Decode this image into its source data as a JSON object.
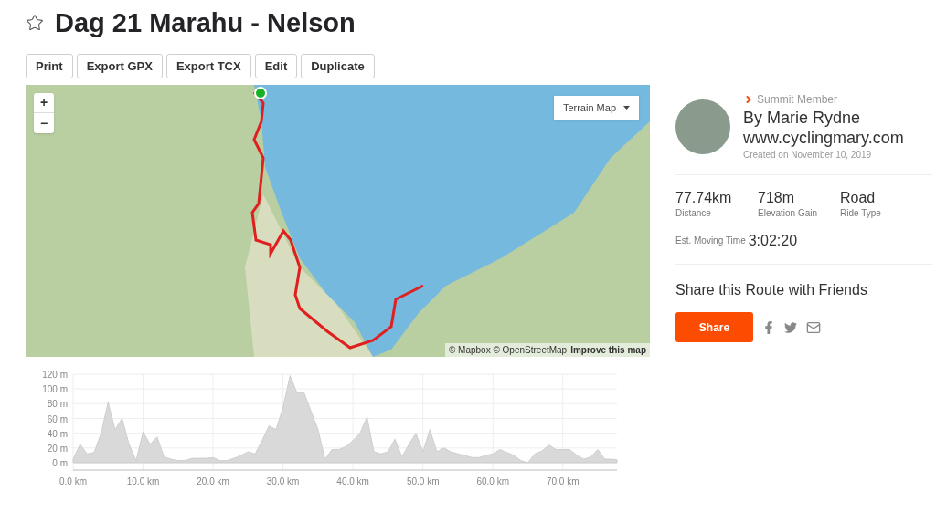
{
  "route": {
    "title": "Dag 21 Marahu - Nelson",
    "starred": false
  },
  "actions": [
    "Print",
    "Export GPX",
    "Export TCX",
    "Edit",
    "Duplicate"
  ],
  "map": {
    "zoom_in": "+",
    "zoom_out": "−",
    "style_menu": "Terrain Map",
    "attribution": "© Mapbox © OpenStreetMap",
    "improve_link": "Improve this map"
  },
  "elevation": {
    "chart_data": {
      "type": "area",
      "grid": true,
      "x": [
        0,
        1,
        2,
        3,
        4,
        5,
        6,
        7,
        8,
        9,
        10,
        11,
        12,
        13,
        14,
        15,
        16,
        17,
        18,
        19,
        20,
        21,
        22,
        23,
        24,
        25,
        26,
        27,
        28,
        29,
        30,
        31,
        32,
        33,
        34,
        35,
        36,
        37,
        38,
        39,
        40,
        41,
        42,
        43,
        44,
        45,
        46,
        47,
        48,
        49,
        50,
        51,
        52,
        53,
        54,
        55,
        56,
        57,
        58,
        59,
        60,
        61,
        62,
        63,
        64,
        65,
        66,
        67,
        68,
        69,
        70,
        71,
        72,
        73,
        74,
        75,
        76,
        77,
        77.74
      ],
      "series": [
        {
          "color": "#d9d9d9",
          "values": [
            5,
            25,
            12,
            14,
            40,
            82,
            45,
            60,
            25,
            3,
            42,
            25,
            35,
            8,
            5,
            3,
            3,
            6,
            6,
            6,
            7,
            3,
            3,
            6,
            10,
            15,
            12,
            30,
            50,
            45,
            75,
            118,
            95,
            95,
            70,
            45,
            5,
            18,
            18,
            22,
            30,
            40,
            62,
            15,
            12,
            15,
            32,
            8,
            25,
            40,
            15,
            45,
            15,
            20,
            15,
            12,
            10,
            7,
            7,
            10,
            12,
            18,
            14,
            10,
            3,
            0,
            12,
            16,
            24,
            18,
            18,
            18,
            10,
            5,
            8,
            18,
            5,
            5,
            4
          ]
        }
      ],
      "xlim": [
        0,
        77.74
      ],
      "ylim": [
        0,
        120
      ],
      "xticks": [
        {
          "value": 0,
          "label": "0.0 km"
        },
        {
          "value": 10,
          "label": "10.0 km"
        },
        {
          "value": 20,
          "label": "20.0 km"
        },
        {
          "value": 30,
          "label": "30.0 km"
        },
        {
          "value": 40,
          "label": "40.0 km"
        },
        {
          "value": 50,
          "label": "50.0 km"
        },
        {
          "value": 60,
          "label": "60.0 km"
        },
        {
          "value": 70,
          "label": "70.0 km"
        }
      ],
      "yticks": [
        {
          "value": 0,
          "label": "0 m"
        },
        {
          "value": 20,
          "label": "20 m"
        },
        {
          "value": 40,
          "label": "40 m"
        },
        {
          "value": 60,
          "label": "60 m"
        },
        {
          "value": 80,
          "label": "80 m"
        },
        {
          "value": 100,
          "label": "100 m"
        },
        {
          "value": 120,
          "label": "120 m"
        }
      ]
    }
  },
  "author": {
    "badge": "Summit Member",
    "name": "By Marie Rydne",
    "website": "www.cyclingmary.com",
    "created": "Created on November 10, 2019"
  },
  "stats": [
    {
      "value": "77.74km",
      "label": "Distance"
    },
    {
      "value": "718m",
      "label": "Elevation Gain"
    },
    {
      "value": "Road",
      "label": "Ride Type"
    }
  ],
  "moving_time": {
    "label": "Est. Moving Time",
    "value": "3:02:20"
  },
  "share": {
    "heading": "Share this Route with Friends",
    "button": "Share"
  }
}
